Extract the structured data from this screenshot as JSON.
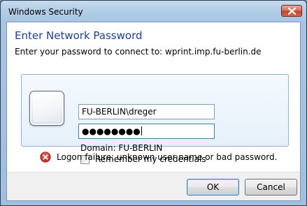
{
  "window": {
    "title": "Windows Security"
  },
  "dialog": {
    "heading": "Enter Network Password",
    "subheading": "Enter your password to connect to: wprint.imp.fu-berlin.de"
  },
  "credentials": {
    "username_value": "FU-BERLIN\\dreger",
    "password_masked": "●●●●●●●●",
    "domain_text": "Domain: FU-BERLIN",
    "remember_label": "Remember my credentials",
    "remember_checked": false
  },
  "error": {
    "message": "Logon failure: unknown user name or bad password.",
    "icon": "error-icon"
  },
  "buttons": {
    "ok": "OK",
    "cancel": "Cancel"
  },
  "icons": {
    "close": "close-icon",
    "user_tile": "user-tile-icon"
  },
  "colors": {
    "heading": "#1f3f8b",
    "close_button": "#c2422b",
    "error_icon": "#c8372d",
    "focus_border": "#3c7fb1"
  }
}
